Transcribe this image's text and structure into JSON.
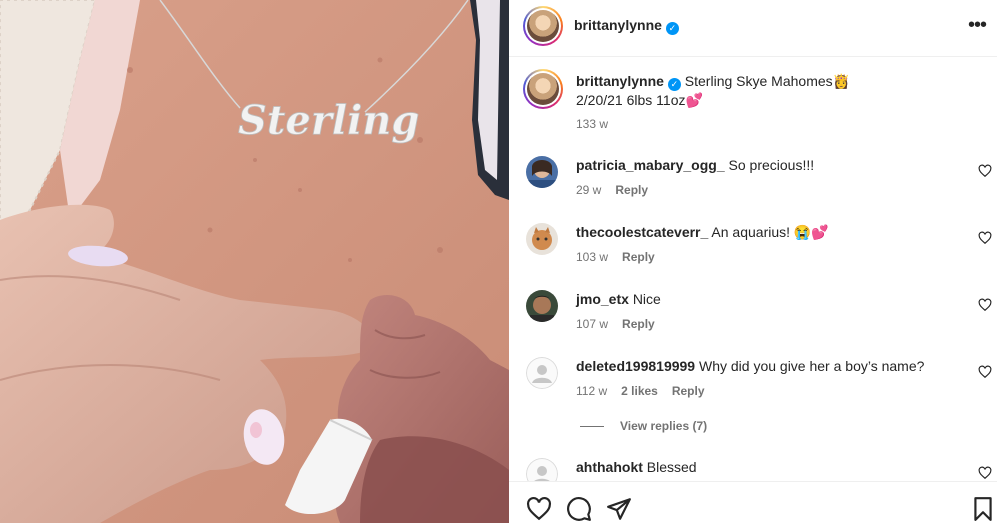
{
  "header": {
    "username": "brittanylynne",
    "verified_icon": "verified-badge-icon",
    "more_icon": "more-options-icon"
  },
  "caption": {
    "username": "brittanylynne",
    "text_line1": "Sterling Skye Mahomes👸",
    "text_line2": "2/20/21 6lbs 11oz💕",
    "time": "133 w"
  },
  "comments": [
    {
      "username": "patricia_mabary_ogg_",
      "text": "So precious!!!",
      "time": "29 w",
      "likes": "",
      "reply": "Reply"
    },
    {
      "username": "thecoolestcateverr_",
      "text": "An aquarius! 😭💕",
      "time": "103 w",
      "likes": "",
      "reply": "Reply"
    },
    {
      "username": "jmo_etx",
      "text": "Nice",
      "time": "107 w",
      "likes": "",
      "reply": "Reply"
    },
    {
      "username": "deleted199819999",
      "text": "Why did you give her a boy’s name?",
      "time": "112 w",
      "likes": "2 likes",
      "reply": "Reply"
    },
    {
      "username": "ahthahokt",
      "text": "Blessed",
      "time": "",
      "likes": "",
      "reply": ""
    }
  ],
  "view_replies": "View replies (7)",
  "photo": {
    "necklace_text": "Sterling"
  },
  "actions": {
    "like_icon": "heart-icon",
    "comment_icon": "comment-icon",
    "share_icon": "share-icon",
    "save_icon": "bookmark-icon"
  }
}
